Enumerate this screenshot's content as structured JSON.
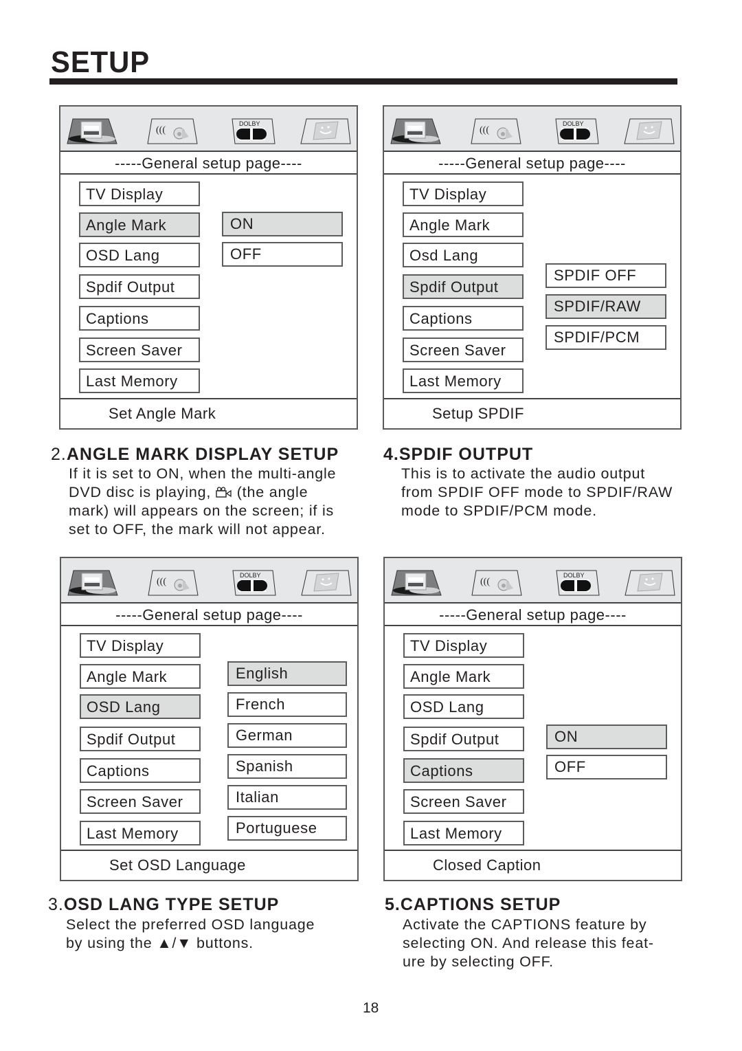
{
  "page": {
    "title": "SETUP",
    "page_number": "18"
  },
  "icons": {
    "tabs": [
      "general-setup-tab-icon",
      "audio-setup-tab-icon",
      "dolby-setup-tab-icon",
      "preference-setup-tab-icon"
    ],
    "dolby_label": "DOLBY"
  },
  "panels": [
    {
      "title": "-----General setup page----",
      "menu": [
        "TV Display",
        "Angle Mark",
        "OSD Lang",
        "Spdif Output",
        "Captions",
        "Screen Saver",
        "Last Memory"
      ],
      "selected_menu": 1,
      "options": [
        "ON",
        "OFF"
      ],
      "selected_option": 0,
      "footer": "Set Angle Mark"
    },
    {
      "title": "-----General setup page----",
      "menu": [
        "TV Display",
        "Angle Mark",
        "Osd Lang",
        "Spdif Output",
        "Captions",
        "Screen Saver",
        "Last Memory"
      ],
      "selected_menu": 3,
      "options": [
        "SPDIF OFF",
        "SPDIF/RAW",
        "SPDIF/PCM"
      ],
      "selected_option": 1,
      "footer": "Setup SPDIF"
    },
    {
      "title": "-----General setup page----",
      "menu": [
        "TV Display",
        "Angle Mark",
        "OSD Lang",
        "Spdif Output",
        "Captions",
        "Screen Saver",
        "Last Memory"
      ],
      "selected_menu": 2,
      "options": [
        "English",
        "French",
        "German",
        "Spanish",
        "Italian",
        "Portuguese"
      ],
      "selected_option": 0,
      "footer": "Set OSD Language"
    },
    {
      "title": "-----General setup page----",
      "menu": [
        "TV Display",
        "Angle Mark",
        "OSD Lang",
        "Spdif Output",
        "Captions",
        "Screen Saver",
        "Last Memory"
      ],
      "selected_menu": 4,
      "options": [
        "ON",
        "OFF"
      ],
      "selected_option": 0,
      "footer": "Closed Caption"
    }
  ],
  "sections": {
    "angle_mark": {
      "number": "2.",
      "heading": "ANGLE MARK DISPLAY SETUP",
      "line1": "If it is set to ON, when the multi-angle",
      "line2_pre": "DVD disc is playing, ",
      "line2_post": " (the angle",
      "line3": "mark) will appears on the screen; if is",
      "line4": "set to OFF, the mark will not appear."
    },
    "spdif": {
      "number": "4.",
      "heading": "SPDIF OUTPUT",
      "body": "This is to activate the audio output\nfrom SPDIF OFF mode to SPDIF/RAW\nmode to SPDIF/PCM mode."
    },
    "osd_lang": {
      "number": "3.",
      "heading": "OSD LANG TYPE SETUP",
      "body": "Select the preferred OSD language\nby using the ▲/▼ buttons."
    },
    "captions": {
      "number": "5.",
      "heading": "CAPTIONS SETUP",
      "body": "Activate the CAPTIONS feature by\nselecting ON.  And release this feat-\nure by selecting OFF."
    }
  }
}
